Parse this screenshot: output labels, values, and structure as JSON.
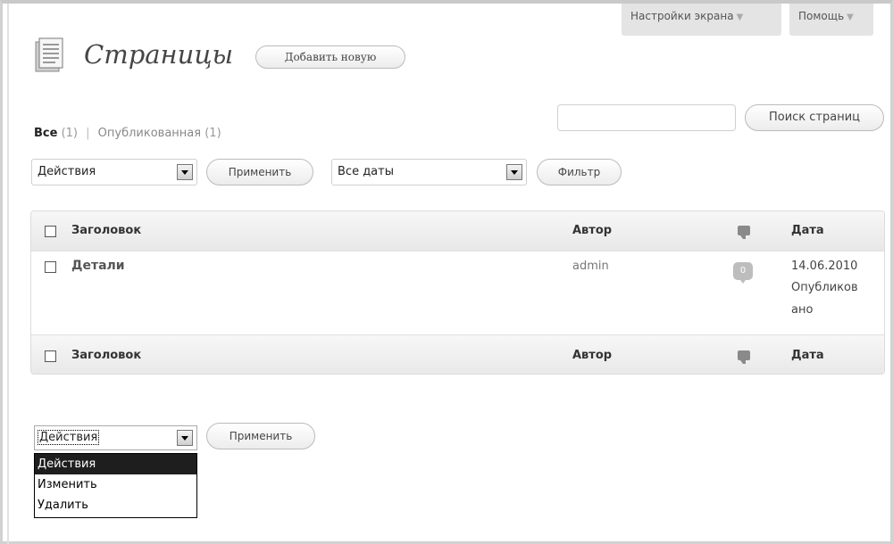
{
  "screen_options": {
    "label": "Настройки экрана"
  },
  "help": {
    "label": "Помощь"
  },
  "header": {
    "title": "Страницы",
    "add_new_label": "Добавить новую"
  },
  "filters": {
    "all_label": "Все",
    "all_count": "(1)",
    "separator": "|",
    "published_label": "Опубликованная",
    "published_count": "(1)"
  },
  "search": {
    "value": "",
    "button_label": "Поиск страниц"
  },
  "bulk_top": {
    "selected": "Действия",
    "apply_label": "Применить"
  },
  "date_filter": {
    "selected": "Все даты",
    "filter_label": "Фильтр"
  },
  "table": {
    "columns": {
      "title": "Заголовок",
      "author": "Автор",
      "date": "Дата"
    },
    "rows": [
      {
        "title": "Детали",
        "author": "admin",
        "comments": "0",
        "date": "14.06.2010",
        "status_line1": "Опубликов",
        "status_line2": "ано"
      }
    ]
  },
  "bulk_bottom": {
    "selected": "Действия",
    "apply_label": "Применить",
    "options": [
      "Действия",
      "Изменить",
      "Удалить"
    ]
  },
  "colors": {
    "header_bg": "#e8e8e8",
    "selected_option_bg": "#1e1e1e"
  }
}
